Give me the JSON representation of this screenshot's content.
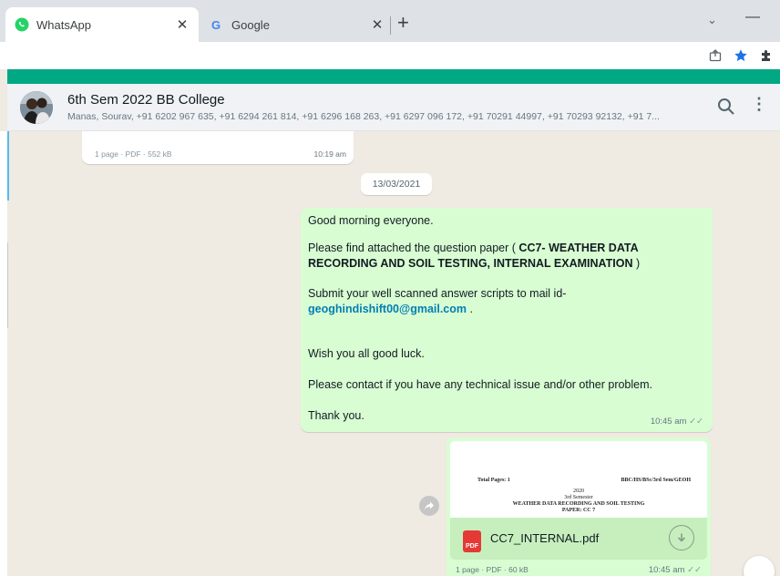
{
  "browser": {
    "tabs": [
      {
        "title": "WhatsApp",
        "close": "✕",
        "icon": "whatsapp-icon",
        "active": true
      },
      {
        "title": "Google",
        "close": "✕",
        "icon": "google-icon",
        "active": false
      }
    ],
    "new_tab": "+",
    "chevron": "⌄",
    "minimize": "—",
    "toolbar_icons": [
      "share-icon",
      "bookmark-star-icon",
      "extensions-icon"
    ]
  },
  "colors": {
    "accent": "#00a884",
    "outgoing_bubble": "#d9fdd3",
    "link": "#027eb5",
    "bookmark_star": "#1a73e8"
  },
  "chat": {
    "name": "6th Sem 2022 BB College",
    "members": "Manas, Sourav, +91 6202 967 635, +91 6294 261 814, +91 6296 168 263, +91 6297 096 172, +91 70291 44997, +91 70293 92132, +91 7...",
    "search_icon": "search-icon",
    "menu": "⋮"
  },
  "messages": {
    "prev_doc_meta": "1 page · PDF · 552 kB",
    "prev_doc_time": "10:19 am",
    "date_chip": "13/03/2021",
    "text_message": {
      "greeting": "Good morning everyone.",
      "attach_prefix": "Please find attached the question paper ( ",
      "attach_bold": "CC7- WEATHER DATA RECORDING AND SOIL TESTING, INTERNAL EXAMINATION",
      "attach_suffix": " )",
      "submit_line": "Submit your well scanned answer scripts to mail id-",
      "email": "geoghindishift00@gmail.com",
      "email_suffix": " .",
      "luck": "Wish you all good luck.",
      "contact": "Please contact if you have any technical issue and/or other problem.",
      "thanks": "Thank you.",
      "time": "10:45 am"
    },
    "document": {
      "preview_total": "Total Pages: 1",
      "preview_code": "BBC/HS/BSc/3rd Sem/GEOH",
      "preview_year": "2020",
      "preview_semester": "3rd Semester",
      "preview_subject": "WEATHER DATA RECORDING AND SOIL TESTING",
      "preview_paper": "PAPER: CC 7",
      "filename": "CC7_INTERNAL.pdf",
      "pdf_label": "PDF",
      "meta": "1 page · PDF · 60 kB",
      "time": "10:45 am"
    }
  }
}
